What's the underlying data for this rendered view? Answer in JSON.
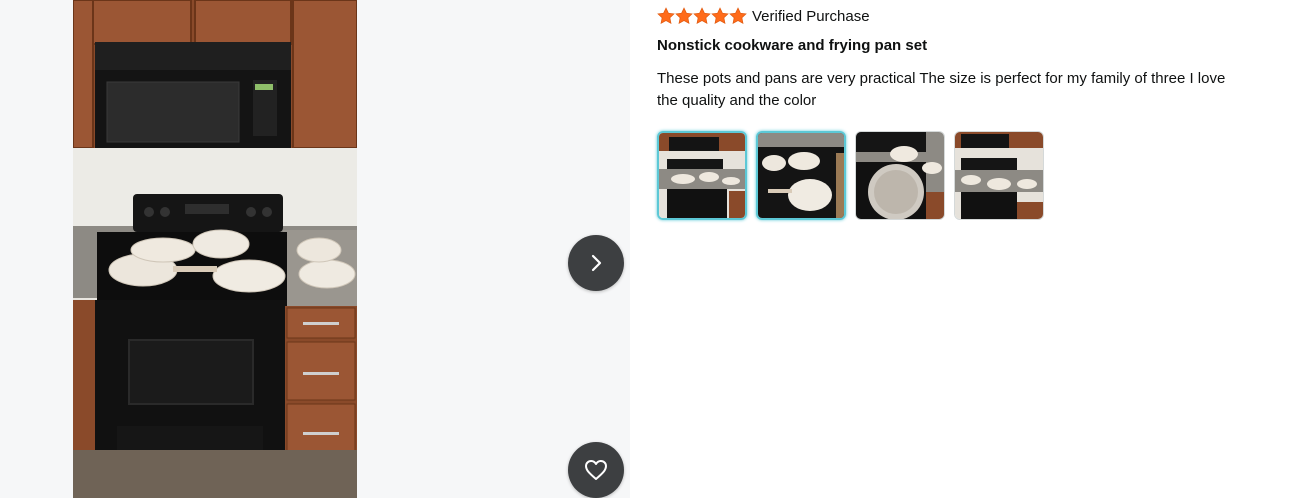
{
  "viewer": {
    "next_label": "Next image",
    "favorite_label": "Add to favorites"
  },
  "review": {
    "rating": 5,
    "rating_max": 5,
    "star_color": "#ff6b1a",
    "verified_text": "Verified Purchase",
    "title": "Nonstick cookware and frying pan set",
    "body": "These pots and pans are very practical The size is perfect for my family of three I love the quality and the color",
    "thumbnails": [
      {
        "selected": true
      },
      {
        "selected": true
      },
      {
        "selected": false
      },
      {
        "selected": false
      }
    ]
  },
  "colors": {
    "viewer_bg": "#f6f7f8",
    "control_bg": "#3d3f41",
    "selected_border": "#5cc8d6"
  }
}
